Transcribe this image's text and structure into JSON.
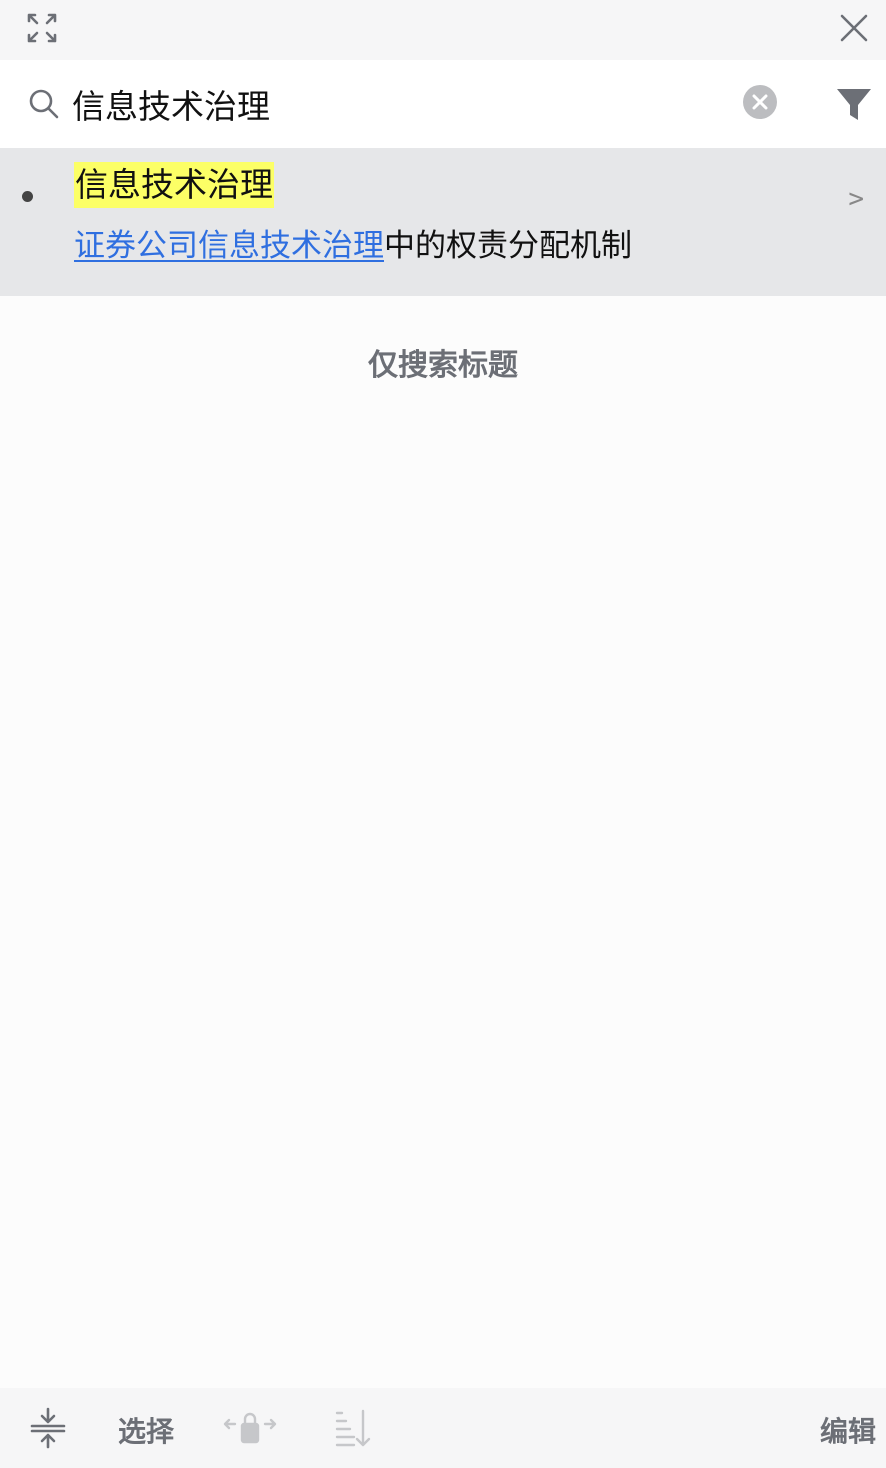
{
  "search": {
    "value": "信息技术治理"
  },
  "results": [
    {
      "title": "信息技术治理",
      "parent_link": "证券公司信息技术治理",
      "parent_suffix": "中的权责分配机制",
      "chevron": ">"
    }
  ],
  "title_only_label": "仅搜索标题",
  "bottom": {
    "select_label": "选择",
    "edit_label": "编辑"
  },
  "colors": {
    "highlight": "#fcff66",
    "link": "#2f6fe0",
    "muted": "#6c6f76"
  },
  "icons": {
    "top_left": "expand-icon",
    "top_right": "close-icon",
    "search": "search-icon",
    "clear": "clear-icon",
    "filter": "filter-icon",
    "collapse": "collapse-icon",
    "move": "move-lock-icon",
    "sort": "sort-icon"
  }
}
